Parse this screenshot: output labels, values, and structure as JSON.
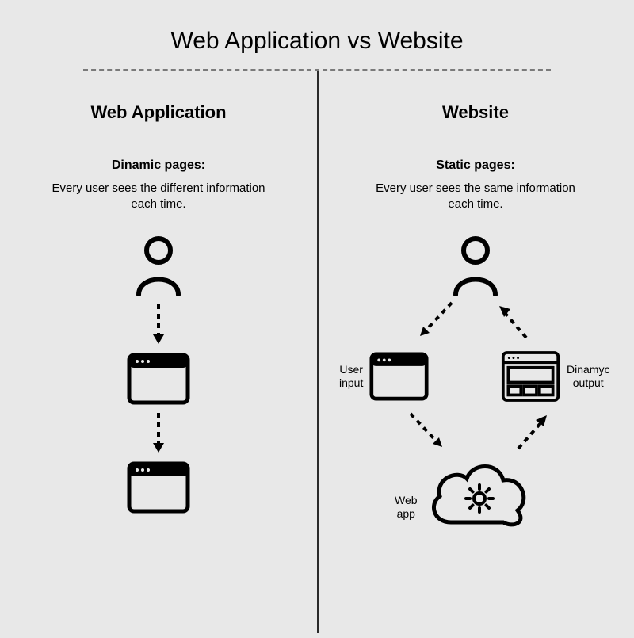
{
  "title": "Web Application vs Website",
  "left": {
    "heading": "Web Application",
    "subheading": "Dinamic pages:",
    "body": "Every user sees the different information each time."
  },
  "right": {
    "heading": "Website",
    "subheading": "Static pages:",
    "body": "Every user sees the same information each time.",
    "labels": {
      "user_input": "User\ninput",
      "dynamic_output": "Dinamyc\noutput",
      "web_app": "Web\napp"
    }
  }
}
